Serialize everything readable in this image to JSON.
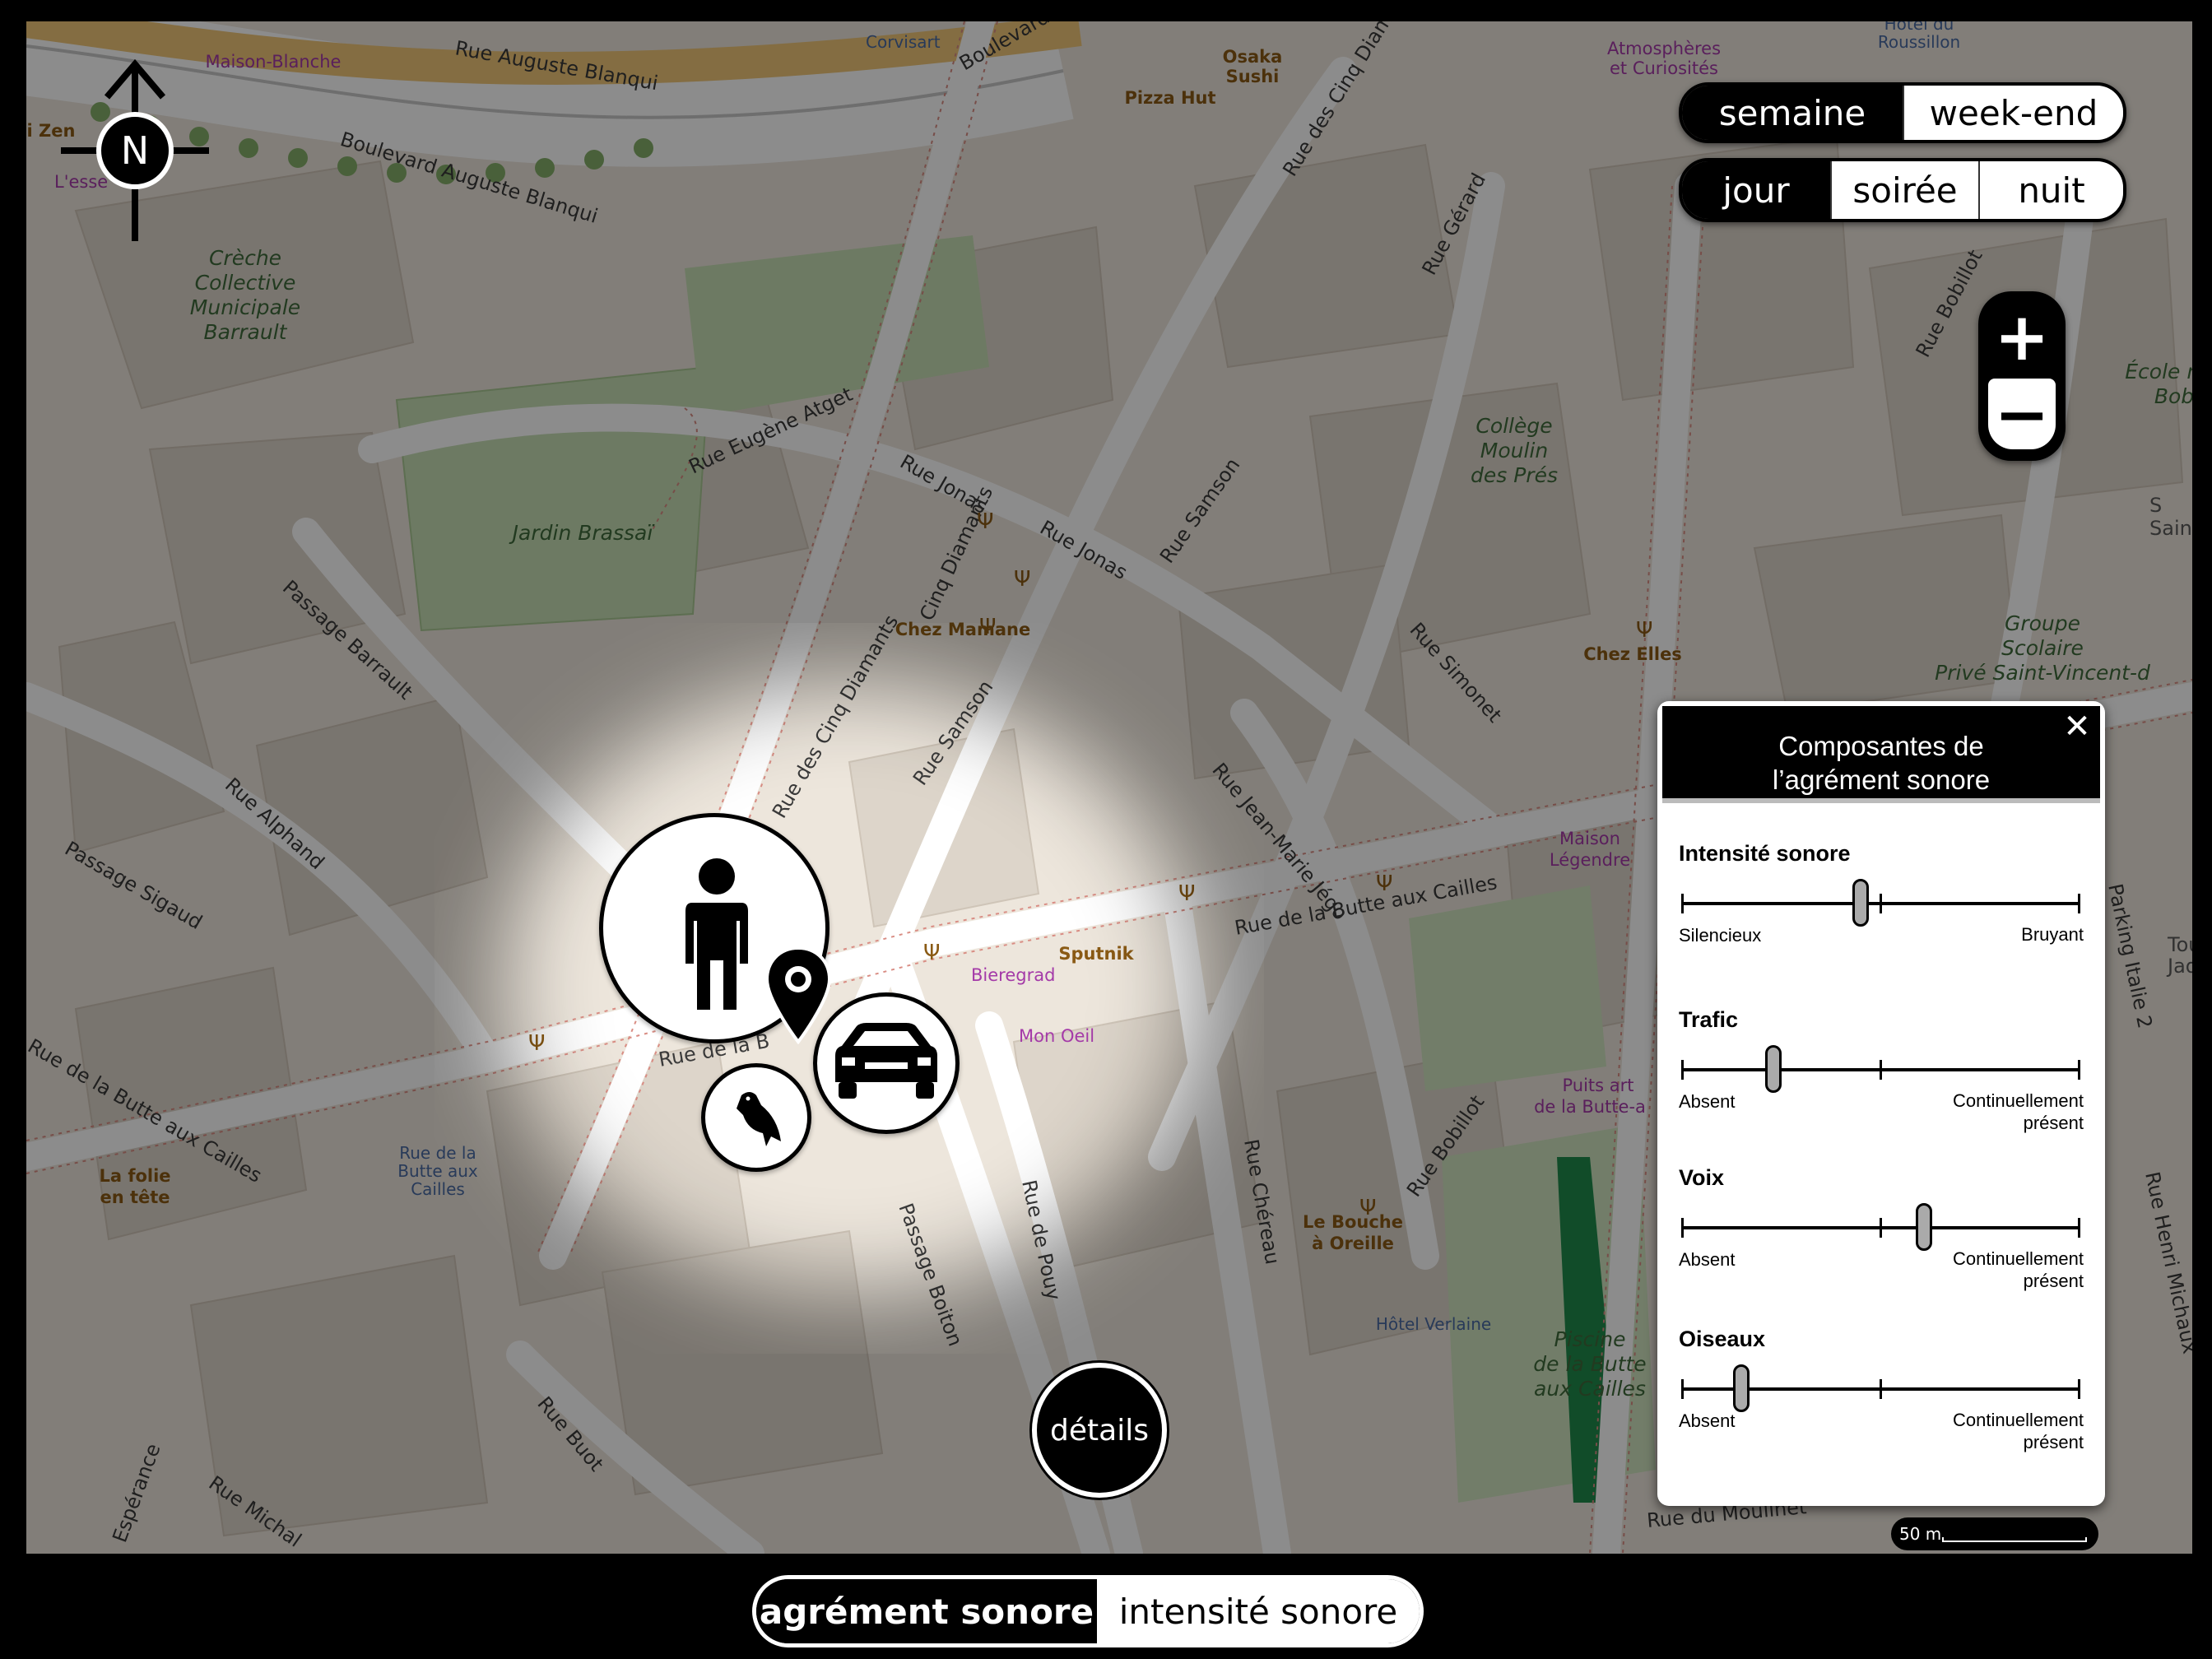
{
  "map": {
    "streets": {
      "auguste_blanqui_1": "Rue Auguste Blanqui",
      "auguste_blanqui_2": "Boulevard Auguste Blanqui",
      "boulevard": "Boulevard",
      "corvisart": "Corvisart",
      "cinq_diamants_1": "Rue des Cinq Diamants",
      "cinq_diamants_2": "Cinq Diamants",
      "cinq_diamants_3": "Rue des Cinq Diamants",
      "gerard": "Rue Gérard",
      "bobillot_1": "Rue Bobillot",
      "bobillot_2": "Rue Bobillot",
      "eugene_atget": "Rue Eugène Atget",
      "jonas_1": "Rue Jonas",
      "jonas_2": "Rue Jonas",
      "samson_1": "Rue Samson",
      "samson_2": "Rue Samson",
      "simonet": "Rue Simonet",
      "passage_barrault": "Passage Barrault",
      "alphand": "Rue Alphand",
      "passage_sigaud": "Passage Sigaud",
      "jean_marie_jego": "Rue Jean-Marie Jégo",
      "butte_aux_cailles_1": "Rue de la Butte aux Cailles",
      "butte_aux_cailles_2": "Rue de la Butte aux Cailles",
      "butte_aux_cailles_3": "Rue de la B",
      "chereau": "Rue Chéreau",
      "de_pouy": "Rue de Pouy",
      "passage_boiton": "Passage Boiton",
      "buot": "Rue Buot",
      "michal": "Rue Michal",
      "esperance": "Espérance",
      "parking_italie": "Parking Italie 2",
      "henri_michaux": "Rue Henri Michaux",
      "moulinet": "Rue du Moulinet"
    },
    "places": {
      "creche": [
        "Crèche",
        "Collective",
        "Municipale",
        "Barrault"
      ],
      "jardin": "Jardin Brassaï",
      "college": [
        "Collège",
        "Moulin",
        "des Prés"
      ],
      "groupe": [
        "Groupe",
        "Scolaire",
        "Privé Saint-Vincent-d"
      ],
      "ecole": [
        "École m",
        "Bob"
      ],
      "piscine": [
        "Piscine",
        "de la Butte",
        "aux Cailles"
      ],
      "maison": [
        "Maison",
        "Légendre"
      ],
      "puits": [
        "Puits art",
        "de la Butte-a"
      ],
      "atmospheres": [
        "Atmosphères",
        "et Curiosités"
      ],
      "hotel_roussillon": [
        "Hôtel du",
        "Roussillon"
      ],
      "maison_blanche": "Maison-Blanche"
    },
    "pois": {
      "osaka": [
        "Osaka",
        "Sushi"
      ],
      "pizza": "Pizza Hut",
      "zen": "i Zen",
      "chez_mamane": "Chez Mamane",
      "chez_elles": "Chez Elles",
      "spoutnik": "Sputnik",
      "bieregrad": "Bieregrad",
      "mon_oeil": "Mon Oeil",
      "folie": [
        "La folie",
        "en tête"
      ],
      "bouche": [
        "Le Bouche",
        "à Oreille"
      ],
      "hotel_verlaine": "Hôtel Verlaine",
      "velib": [
        "Rue de la",
        "Butte aux",
        "Cailles"
      ],
      "tour_jad": [
        "Tou",
        "Jad"
      ],
      "sain": [
        "Sain",
        "S"
      ],
      "lesse": "L'esse"
    }
  },
  "compass": {
    "label": "N"
  },
  "week_toggle": {
    "options": [
      "semaine",
      "week-end"
    ],
    "selected": "semaine"
  },
  "time_toggle": {
    "options": [
      "jour",
      "soirée",
      "nuit"
    ],
    "selected": "jour"
  },
  "zoom": {
    "in_label": "+",
    "out_label": "−"
  },
  "markers": {
    "person": "person-icon",
    "car": "car-icon",
    "bird": "bird-icon",
    "pin": "location-pin-icon"
  },
  "details_button": "détails",
  "panel": {
    "title_line1": "Composantes de",
    "title_line2": "l’agrément sonore",
    "close_label": "✕",
    "sliders": [
      {
        "title": "Intensité sonore",
        "left": "Silencieux",
        "right_1": "Bruyant",
        "right_2": "",
        "value": 0.45
      },
      {
        "title": "Trafic",
        "left": "Absent",
        "right_1": "Continuellement",
        "right_2": "présent",
        "value": 0.23
      },
      {
        "title": "Voix",
        "left": "Absent",
        "right_1": "Continuellement",
        "right_2": "présent",
        "value": 0.61
      },
      {
        "title": "Oiseaux",
        "left": "Absent",
        "right_1": "Continuellement",
        "right_2": "présent",
        "value": 0.15
      }
    ]
  },
  "scale": {
    "label": "50 m"
  },
  "mode_toggle": {
    "options": [
      "agrément sonore",
      "intensité sonore"
    ],
    "selected": "agrément sonore"
  },
  "colors": {
    "accent": "#000000",
    "panel_bg": "#ffffff",
    "spotlight": "#f3ece2",
    "dim_overlay": "rgba(0,0,0,0.45)"
  }
}
